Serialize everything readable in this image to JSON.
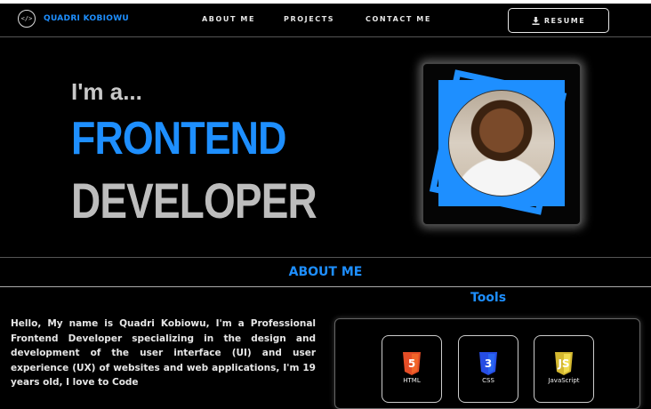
{
  "nav": {
    "logo_glyph": "</>",
    "brand": "QUADRI KOBIOWU",
    "links": [
      "ABOUT ME",
      "PROJECTS",
      "CONTACT ME"
    ],
    "resume_label": "RESUME"
  },
  "hero": {
    "intro": "I'm a...",
    "role_line1": "FRONTEND",
    "role_line2": "DEVELOPER"
  },
  "about": {
    "section_title": "ABOUT ME",
    "text": "Hello, My name is Quadri Kobiowu, I'm a Professional Frontend Developer specializing in the design and development of the user interface (UI) and user experience (UX) of websites and web applications, I'm 19 years old, I love to Code"
  },
  "tools": {
    "title": "Tools",
    "items": [
      {
        "label": "HTML",
        "icon": "html5-icon",
        "color": "#e44d26"
      },
      {
        "label": "CSS",
        "icon": "css3-icon",
        "color": "#264de4"
      },
      {
        "label": "JavaScript",
        "icon": "javascript-icon",
        "color": "#f0db4f"
      }
    ]
  },
  "colors": {
    "accent": "#1e8fff",
    "background": "#000000"
  }
}
